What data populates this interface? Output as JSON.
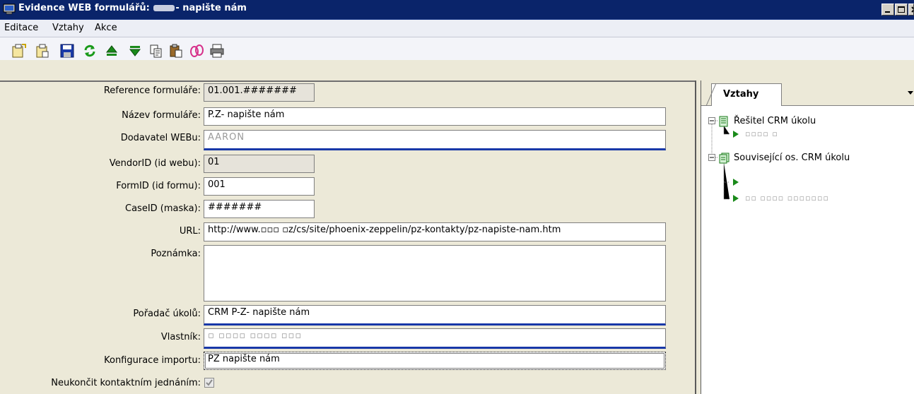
{
  "window": {
    "title_prefix": "Evidence WEB formulářů: ",
    "title_suffix": "- napište nám",
    "title_redacted": "■■■",
    "minimize_icon": "minimize-icon",
    "maximize_icon": "maximize-icon",
    "close_icon": "close-icon"
  },
  "menu": [
    "Editace",
    "Vztahy",
    "Akce"
  ],
  "toolbar": [
    {
      "name": "new-record-icon"
    },
    {
      "name": "copy-record-icon"
    },
    {
      "name": "save-icon"
    },
    {
      "name": "refresh-icon"
    },
    {
      "name": "move-up-icon"
    },
    {
      "name": "move-down-icon"
    },
    {
      "name": "copy-icon"
    },
    {
      "name": "paste-icon"
    },
    {
      "name": "link-icon"
    },
    {
      "name": "print-icon"
    }
  ],
  "form": {
    "reference_label": "Reference formuláře:",
    "reference_value": "01.001.#######",
    "name_label": "Název formuláře:",
    "name_value": "P.Z- napište nám",
    "vendor_label": "Dodavatel WEBu:",
    "vendor_value": "AARON",
    "vendorid_label": "VendorID (id webu):",
    "vendorid_value": "01",
    "formid_label": "FormID (id formu):",
    "formid_value": "001",
    "caseid_label": "CaseID (maska):",
    "caseid_value": "#######",
    "url_label": "URL:",
    "url_value": "http://www.▫▫▫ ▫z/cs/site/phoenix-zeppelin/pz-kontakty/pz-napiste-nam.htm",
    "note_label": "Poznámka:",
    "note_value": "",
    "sorter_label": "Pořadač úkolů:",
    "sorter_value": "CRM P-Z- napište nám",
    "owner_label": "Vlastník:",
    "owner_value": "▫ ▫▫▫▫ ▫▫▫▫ ▫▫▫",
    "import_label": "Konfigurace importu:",
    "import_value": "PZ napište nám",
    "unfinished_label": "Neukončit kontaktním jednáním:",
    "unfinished_checked": true
  },
  "relations": {
    "tab_label": "Vztahy",
    "node1_label": "Řešitel CRM úkolu",
    "node1_child": "▫▫▫▫ ▫",
    "node2_label": "Související os. CRM úkolu",
    "node2_child1": "",
    "node2_child2": "▫▫ ▫▫▫▫ ▫▫▫▫▫▫▫"
  }
}
